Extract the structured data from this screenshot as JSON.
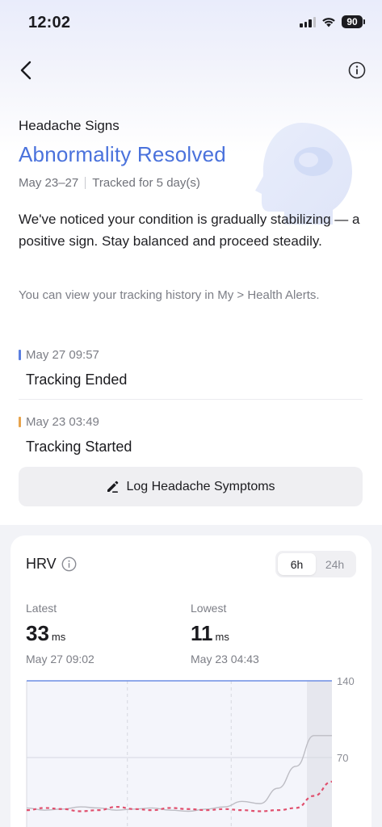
{
  "status_bar": {
    "time": "12:02",
    "battery": "90"
  },
  "header": {
    "category": "Headache Signs",
    "headline": "Abnormality Resolved",
    "date_range": "May 23–27",
    "tracked": "Tracked for 5 day(s)"
  },
  "description": "We've noticed your condition is gradually stabilizing — a positive sign. Stay balanced and proceed steadily.",
  "hint": "You can view your tracking history in My > Health Alerts.",
  "timeline": [
    {
      "time": "May 27 09:57",
      "event": "Tracking Ended",
      "color": "#5b7fe0"
    },
    {
      "time": "May 23 03:49",
      "event": "Tracking Started",
      "color": "#e7a34c"
    }
  ],
  "log_button": "Log Headache Symptoms",
  "hrv": {
    "title": "HRV",
    "tabs": [
      "6h",
      "24h"
    ],
    "active_tab": "6h",
    "latest": {
      "label": "Latest",
      "value": "33",
      "unit": "ms",
      "time": "May 27 09:02"
    },
    "lowest": {
      "label": "Lowest",
      "value": "11",
      "unit": "ms",
      "time": "May 23 04:43"
    }
  },
  "chart_data": {
    "type": "line",
    "y_tick_labels": [
      "140",
      "70"
    ],
    "ylim": [
      0,
      140
    ],
    "grid": true,
    "colors": {
      "baseline": "#6d8ee4",
      "series_gray": "#bdbdc4",
      "series_red": "#e0506e",
      "highlight": "#e6e7ee"
    },
    "series": [
      {
        "style": "gray",
        "values": [
          24,
          22,
          23,
          25,
          24,
          22,
          23,
          24,
          22,
          21,
          23,
          25,
          30,
          28,
          42,
          62,
          90,
          90
        ]
      },
      {
        "style": "red-dashed",
        "values": [
          22,
          24,
          23,
          21,
          22,
          25,
          23,
          22,
          24,
          23,
          22,
          23,
          22,
          21,
          22,
          24,
          35,
          48
        ]
      }
    ]
  }
}
